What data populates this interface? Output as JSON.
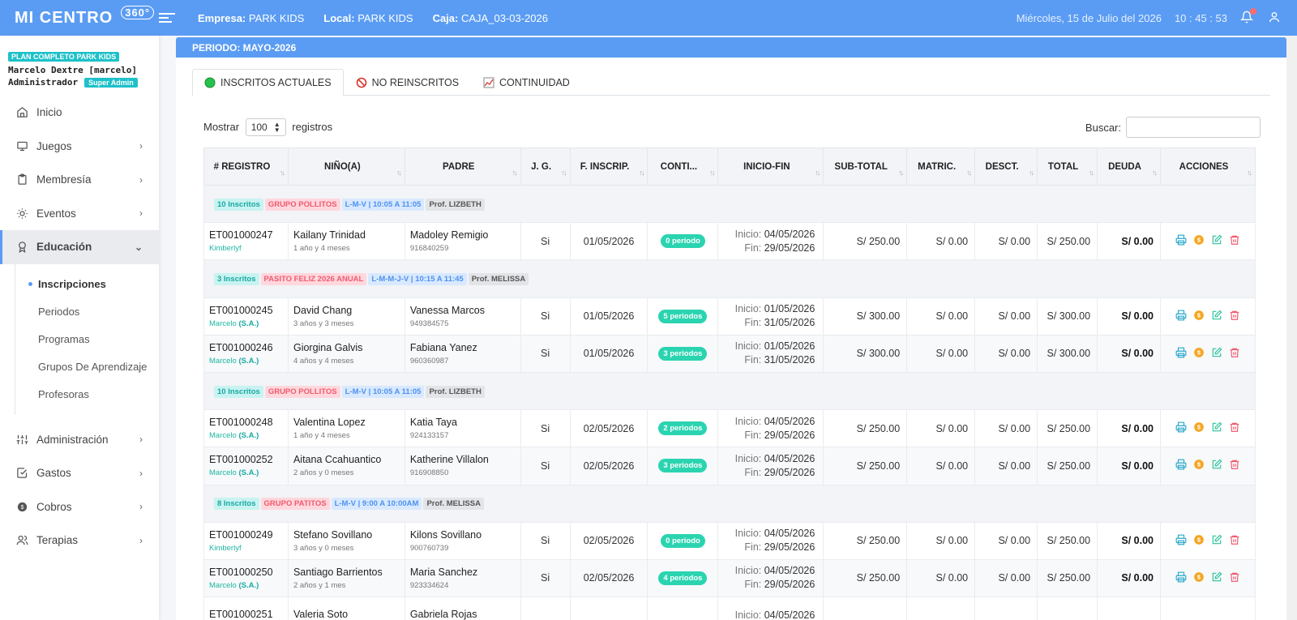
{
  "topbar": {
    "logo": "MI CENTRO",
    "logo_sup": "360°",
    "empresa_label": "Empresa:",
    "empresa_value": "PARK KIDS",
    "local_label": "Local:",
    "local_value": "PARK KIDS",
    "caja_label": "Caja:",
    "caja_value": "CAJA_03-03-2026",
    "date": "Miércoles, 15 de Julio del 2026",
    "time": "10 : 45 : 53"
  },
  "profile": {
    "plan": "PLAN COMPLETO PARK KIDS",
    "name": "Marcelo Dextre [marcelo]",
    "role": "Administrador",
    "badge": "Super Admin"
  },
  "menu": [
    {
      "label": "Inicio",
      "icon": "home-icon",
      "chevron": false
    },
    {
      "label": "Juegos",
      "icon": "monitor-icon",
      "chevron": true
    },
    {
      "label": "Membresía",
      "icon": "clipboard-icon",
      "chevron": true
    },
    {
      "label": "Eventos",
      "icon": "sun-icon",
      "chevron": true
    },
    {
      "label": "Educación",
      "icon": "award-icon",
      "chevron": true,
      "active": true
    }
  ],
  "submenu": [
    {
      "label": "Inscripciones",
      "active": true
    },
    {
      "label": "Periodos"
    },
    {
      "label": "Programas"
    },
    {
      "label": "Grupos De Aprendizaje"
    },
    {
      "label": "Profesoras"
    }
  ],
  "menu2": [
    {
      "label": "Administración",
      "icon": "sliders-icon"
    },
    {
      "label": "Gastos",
      "icon": "checkbox-icon"
    },
    {
      "label": "Cobros",
      "icon": "coins-icon"
    },
    {
      "label": "Terapias",
      "icon": "users-icon"
    }
  ],
  "period": "PERIODO: MAYO-2026",
  "tabs": [
    {
      "label": "INSCRITOS ACTUALES",
      "icon": "green-circle-icon",
      "active": true
    },
    {
      "label": "NO REINSCRITOS",
      "icon": "prohibited-icon"
    },
    {
      "label": "CONTINUIDAD",
      "icon": "chart-icon"
    }
  ],
  "controls": {
    "show_label": "Mostrar",
    "length": "100",
    "records_label": "registros",
    "search_label": "Buscar:"
  },
  "columns": [
    "# REGISTRO",
    "NIÑO(A)",
    "PADRE",
    "J. G.",
    "F. INSCRIP.",
    "CONTI...",
    "INICIO-FIN",
    "SUB-TOTAL",
    "MATRIC.",
    "DESCT.",
    "TOTAL",
    "DEUDA",
    "ACCIONES"
  ],
  "groups": [
    {
      "badges": [
        "10 Inscritos",
        "GRUPO POLLITOS",
        "L-M-V | 10:05 A 11:05",
        "Prof. LIZBETH"
      ],
      "rows": [
        {
          "id": "ET001000247",
          "by": "Kimberlyf",
          "sa": "",
          "child": "Kailany Trinidad",
          "age": "1 año y 4 meses",
          "parent": "Madoley Remigio",
          "phone": "916840259",
          "jg": "Si",
          "date": "01/05/2026",
          "conti": "0 periodo",
          "inicio": "04/05/2026",
          "fin": "29/05/2026",
          "subtotal": "S/ 250.00",
          "matric": "S/ 0.00",
          "desct": "S/ 0.00",
          "total": "S/ 250.00",
          "deuda": "S/ 0.00"
        }
      ]
    },
    {
      "badges": [
        "3 Inscritos",
        "PASITO FELIZ 2026 ANUAL",
        "L-M-M-J-V | 10:15 A 11:45",
        "Prof. MELISSA"
      ],
      "rows": [
        {
          "id": "ET001000245",
          "by": "Marcelo",
          "sa": "(S.A.)",
          "child": "David Chang",
          "age": "3 años y 3 meses",
          "parent": "Vanessa Marcos",
          "phone": "949384575",
          "jg": "Si",
          "date": "01/05/2026",
          "conti": "5 periodos",
          "inicio": "01/05/2026",
          "fin": "31/05/2026",
          "subtotal": "S/ 300.00",
          "matric": "S/ 0.00",
          "desct": "S/ 0.00",
          "total": "S/ 300.00",
          "deuda": "S/ 0.00"
        },
        {
          "id": "ET001000246",
          "by": "Marcelo",
          "sa": "(S.A.)",
          "child": "Giorgina Galvis",
          "age": "4 años y 4 meses",
          "parent": "Fabiana Yanez",
          "phone": "960360987",
          "jg": "Si",
          "date": "01/05/2026",
          "conti": "3 periodos",
          "inicio": "01/05/2026",
          "fin": "31/05/2026",
          "subtotal": "S/ 300.00",
          "matric": "S/ 0.00",
          "desct": "S/ 0.00",
          "total": "S/ 300.00",
          "deuda": "S/ 0.00"
        }
      ]
    },
    {
      "badges": [
        "10 Inscritos",
        "GRUPO POLLITOS",
        "L-M-V | 10:05 A 11:05",
        "Prof. LIZBETH"
      ],
      "rows": [
        {
          "id": "ET001000248",
          "by": "Marcelo",
          "sa": "(S.A.)",
          "child": "Valentina Lopez",
          "age": "1 año y 4 meses",
          "parent": "Katia Taya",
          "phone": "924133157",
          "jg": "Si",
          "date": "02/05/2026",
          "conti": "2 periodos",
          "inicio": "04/05/2026",
          "fin": "29/05/2026",
          "subtotal": "S/ 250.00",
          "matric": "S/ 0.00",
          "desct": "S/ 0.00",
          "total": "S/ 250.00",
          "deuda": "S/ 0.00"
        },
        {
          "id": "ET001000252",
          "by": "Marcelo",
          "sa": "(S.A.)",
          "child": "Aitana Ccahuantico",
          "age": "2 años y 0 meses",
          "parent": "Katherine Villalon",
          "phone": "916908850",
          "jg": "Si",
          "date": "02/05/2026",
          "conti": "3 periodos",
          "inicio": "04/05/2026",
          "fin": "29/05/2026",
          "subtotal": "S/ 250.00",
          "matric": "S/ 0.00",
          "desct": "S/ 0.00",
          "total": "S/ 250.00",
          "deuda": "S/ 0.00"
        }
      ]
    },
    {
      "badges": [
        "8 Inscritos",
        "GRUPO PATITOS",
        "L-M-V | 9:00 A 10:00AM",
        "Prof. MELISSA"
      ],
      "rows": [
        {
          "id": "ET001000249",
          "by": "Kimberlyf",
          "sa": "",
          "child": "Stefano Sovillano",
          "age": "3 años y 0 meses",
          "parent": "Kilons Sovillano",
          "phone": "900760739",
          "jg": "Si",
          "date": "02/05/2026",
          "conti": "0 periodo",
          "inicio": "04/05/2026",
          "fin": "29/05/2026",
          "subtotal": "S/ 250.00",
          "matric": "S/ 0.00",
          "desct": "S/ 0.00",
          "total": "S/ 250.00",
          "deuda": "S/ 0.00"
        },
        {
          "id": "ET001000250",
          "by": "Marcelo",
          "sa": "(S.A.)",
          "child": "Santiago Barrientos",
          "age": "2 años y 1 mes",
          "parent": "Maria Sanchez",
          "phone": "923334624",
          "jg": "Si",
          "date": "02/05/2026",
          "conti": "4 periodos",
          "inicio": "04/05/2026",
          "fin": "29/05/2026",
          "subtotal": "S/ 250.00",
          "matric": "S/ 0.00",
          "desct": "S/ 0.00",
          "total": "S/ 250.00",
          "deuda": "S/ 0.00"
        },
        {
          "id": "ET001000251",
          "by": "",
          "sa": "",
          "child": "Valeria Soto",
          "age": "",
          "parent": "Gabriela Rojas",
          "phone": "",
          "jg": "",
          "date": "",
          "conti": "",
          "inicio": "04/05/2026",
          "fin": "",
          "subtotal": "",
          "matric": "",
          "desct": "",
          "total": "",
          "deuda": ""
        }
      ]
    }
  ],
  "labels": {
    "inicio": "Inicio:",
    "fin": "Fin:"
  },
  "colors": {
    "primary": "#5a9cf3",
    "teal": "#1ec1c9",
    "pill": "#2bd4b0",
    "danger": "#ee5b6f",
    "warning": "#f5a623"
  }
}
